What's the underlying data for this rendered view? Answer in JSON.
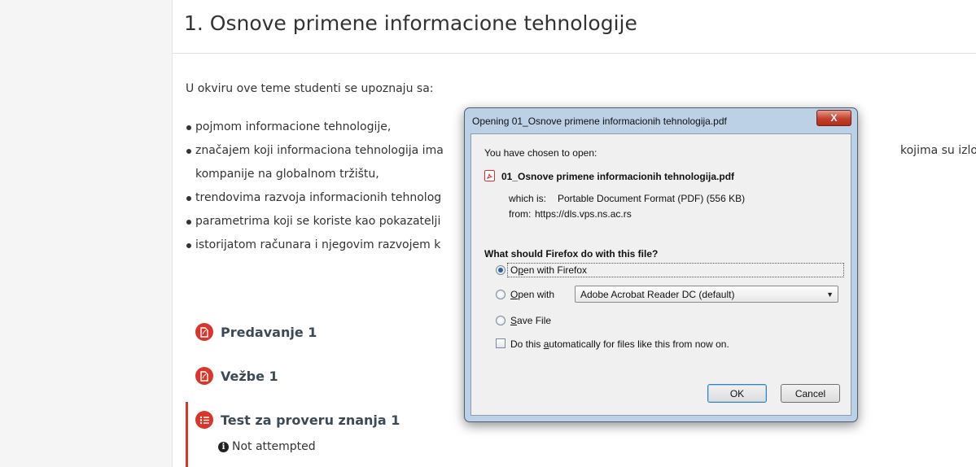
{
  "page": {
    "title": "1. Osnove primene informacione tehnologije",
    "intro": "U okviru ove teme studenti se upoznaju sa:",
    "topics": [
      "pojmom informacione tehnologije,",
      "značajem koji informaciona tehnologija ima",
      "trendovima razvoja informacionih tehnolog",
      "parametrima koji se koriste kao pokazatelji",
      "istorijatom računara i njegovim razvojem k"
    ],
    "topic2_continuation": "kompanije na globalnom tržištu,",
    "topic2_right_fragment": "kojima su izloženi"
  },
  "activities": [
    {
      "label": "Predavanje 1",
      "icon": "pdf-icon"
    },
    {
      "label": "Vežbe 1",
      "icon": "pdf-icon"
    },
    {
      "label": "Test za proveru znanja 1",
      "icon": "quiz-icon",
      "status": "Not attempted"
    }
  ],
  "dialog": {
    "title": "Opening 01_Osnove primene informacionih tehnologija.pdf",
    "close_label": "X",
    "chosen_text": "You have chosen to open:",
    "filename": "01_Osnove primene informacionih tehnologija.pdf",
    "which_is_label": "which is:",
    "which_is_value": "Portable Document Format (PDF) (556 KB)",
    "from_label": "from:",
    "from_value": "https://dls.vps.ns.ac.rs",
    "question": "What should Firefox do with this file?",
    "open_firefox_a": "O",
    "open_firefox_b": "p",
    "open_firefox_c": "en with Firefox",
    "open_with_a": "O",
    "open_with_b": "pen with",
    "open_with_value": "Adobe Acrobat Reader DC  (default)",
    "save_a": "S",
    "save_b": "ave File",
    "auto_a": "Do this ",
    "auto_b": "a",
    "auto_c": "utomatically for files like this from now on.",
    "ok_label": "OK",
    "cancel_label": "Cancel"
  },
  "colors": {
    "accent_red": "#d9362b",
    "dialog_frame": "#bcd0e6"
  }
}
